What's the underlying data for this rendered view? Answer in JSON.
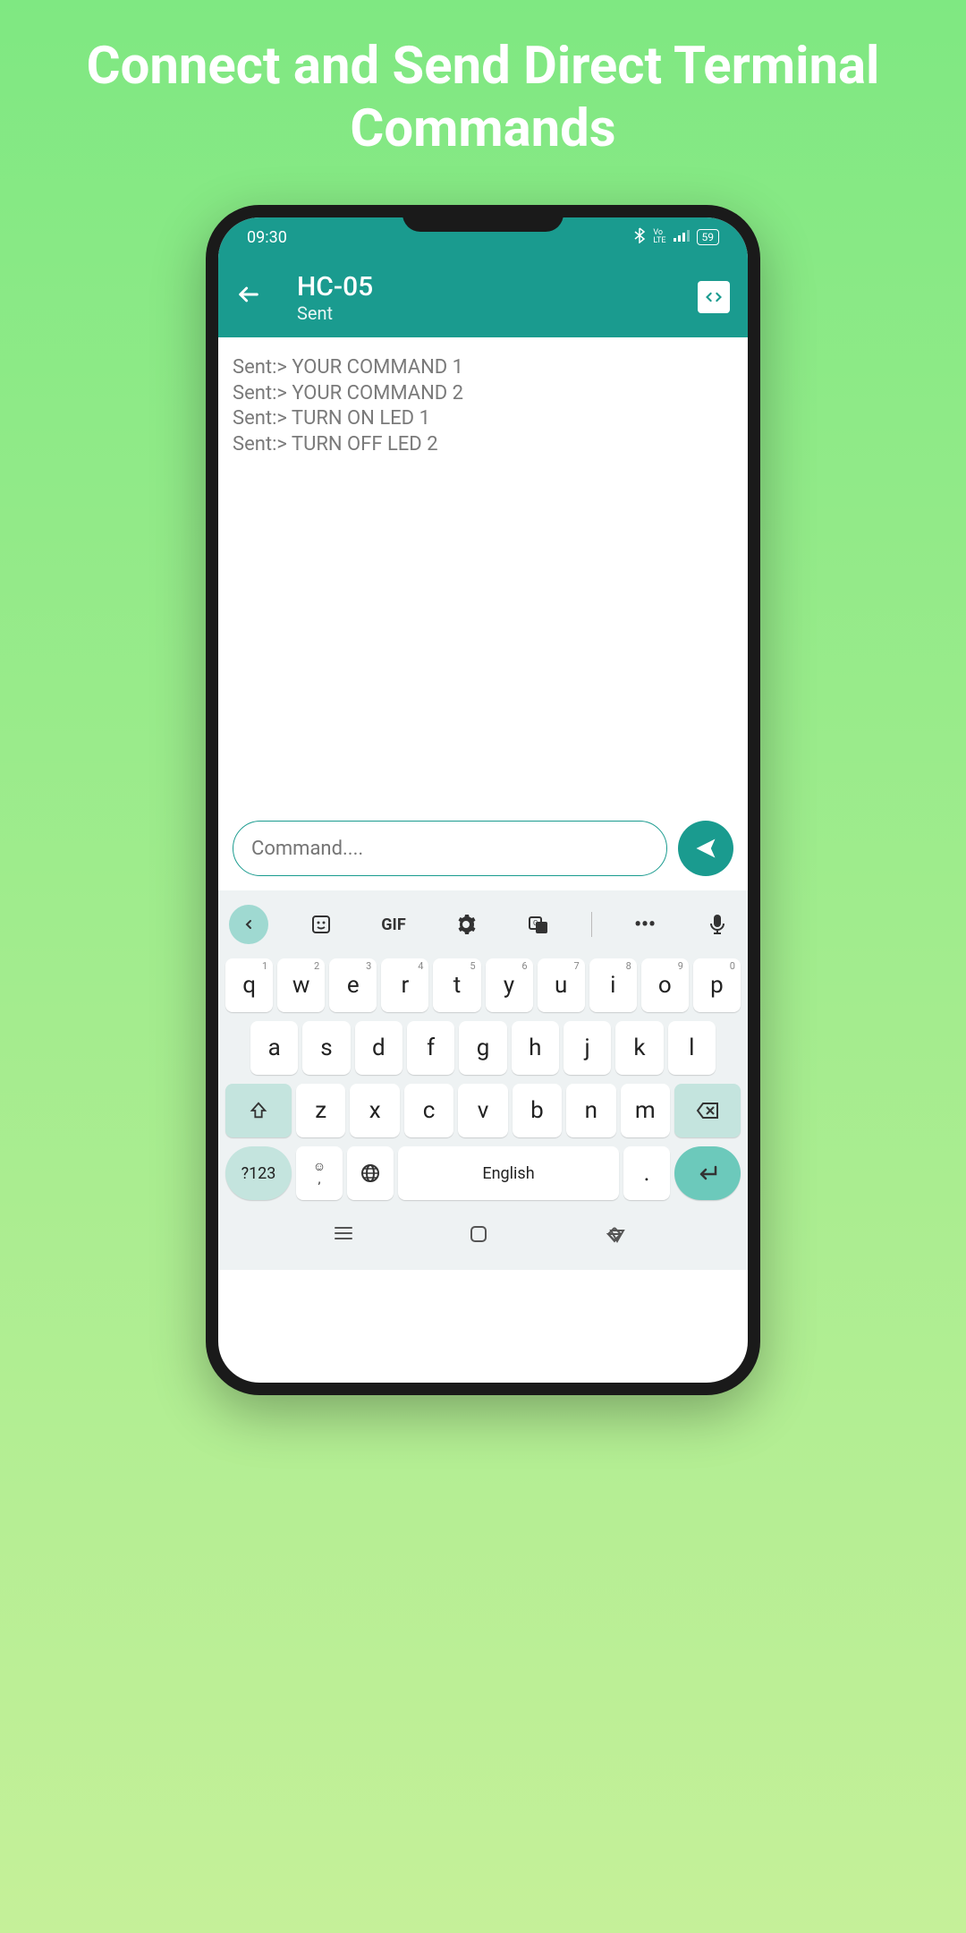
{
  "promo": {
    "title": "Connect and Send Direct Terminal Commands"
  },
  "status": {
    "time": "09:30",
    "battery": "59"
  },
  "header": {
    "title": "HC-05",
    "subtitle": "Sent"
  },
  "terminal": {
    "lines": [
      "Sent:> YOUR COMMAND 1",
      "Sent:> YOUR COMMAND 2",
      "Sent:> TURN ON LED 1",
      "Sent:> TURN OFF LED 2"
    ]
  },
  "command_input": {
    "placeholder": "Command...."
  },
  "keyboard": {
    "toolbar": {
      "gif": "GIF"
    },
    "row1": [
      "q",
      "w",
      "e",
      "r",
      "t",
      "y",
      "u",
      "i",
      "o",
      "p"
    ],
    "row1_sup": [
      "1",
      "2",
      "3",
      "4",
      "5",
      "6",
      "7",
      "8",
      "9",
      "0"
    ],
    "row2": [
      "a",
      "s",
      "d",
      "f",
      "g",
      "h",
      "j",
      "k",
      "l"
    ],
    "row3": [
      "z",
      "x",
      "c",
      "v",
      "b",
      "n",
      "m"
    ],
    "symbols": "?123",
    "space": "English",
    "period": ".",
    "comma": ","
  }
}
